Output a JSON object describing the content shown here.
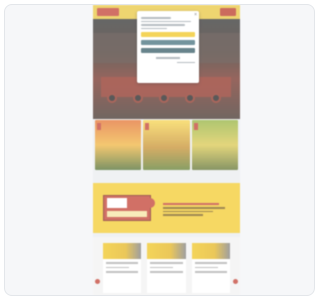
{
  "header": {
    "logo_text": "",
    "menu_label": ""
  },
  "tiles": [
    {
      "tag": ""
    },
    {
      "tag": ""
    },
    {
      "tag": ""
    }
  ],
  "colors": {
    "accent_yellow": "#f3c928",
    "accent_red": "#c0392b",
    "modal_teal": "#3d6b78"
  },
  "icons": {
    "close": "close-icon"
  }
}
